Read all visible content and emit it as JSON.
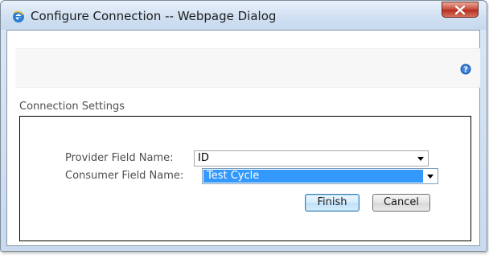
{
  "window": {
    "title": "Configure Connection -- Webpage Dialog"
  },
  "icons": {
    "app": "internet-explorer-icon",
    "close": "close-icon",
    "help": "help-icon",
    "dropdown": "chevron-down-icon"
  },
  "section": {
    "label": "Connection Settings"
  },
  "form": {
    "provider": {
      "label": "Provider Field Name:",
      "value": "ID"
    },
    "consumer": {
      "label": "Consumer Field Name:",
      "value": "Test Cycle"
    }
  },
  "buttons": {
    "finish": "Finish",
    "cancel": "Cancel"
  },
  "colors": {
    "selection": "#3399ff",
    "close_button": "#c8463a",
    "help_icon": "#1a5fb4"
  }
}
